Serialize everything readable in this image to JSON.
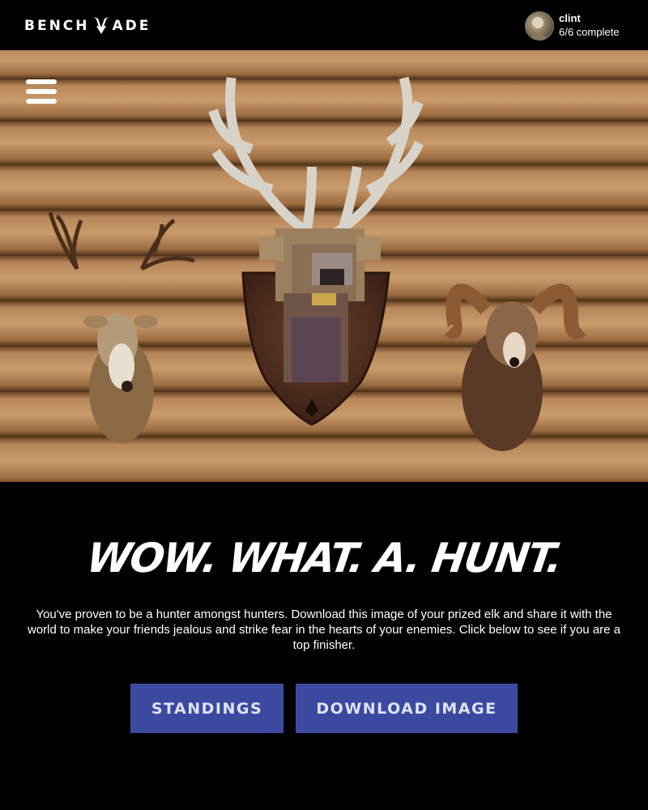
{
  "header": {
    "logo_left": "BENCH",
    "logo_right": "ADE",
    "logo_mark_icon": "butterfly-knife-icon",
    "user": {
      "name": "clint",
      "progress": "6/6 complete"
    }
  },
  "menu": {
    "icon": "hamburger-menu-icon"
  },
  "hero": {
    "trophies": [
      "deer-mount",
      "elk-mount",
      "ram-mount"
    ],
    "plaque_icon": "butterfly-knife-icon"
  },
  "main": {
    "headline": "WOW. WHAT. A. HUNT.",
    "body": "You've proven to be a hunter amongst hunters. Download this image of your prized elk and share it with the world to make your friends jealous and strike fear in the hearts of your enemies. Click below to see if you are a top finisher.",
    "standings_label": "STANDINGS",
    "download_label": "DOWNLOAD IMAGE"
  },
  "colors": {
    "background": "#000000",
    "button": "#3b4aa0",
    "button_text": "#dfe3ff",
    "wood": "#9c6f43"
  }
}
